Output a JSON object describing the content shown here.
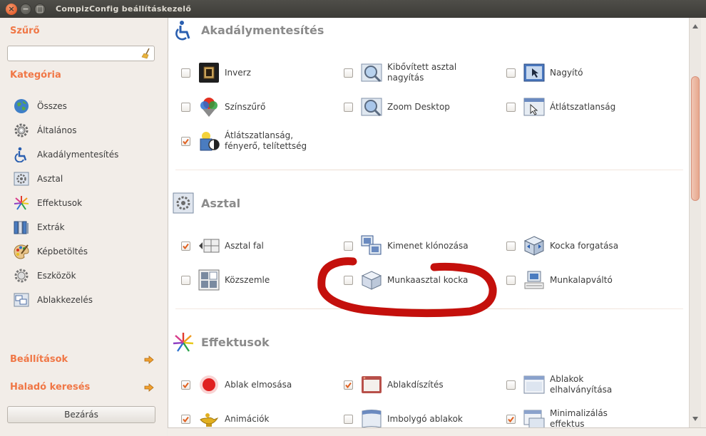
{
  "window": {
    "title": "CompizConfig beállításkezelő"
  },
  "sidebar": {
    "filter_label": "Szűrő",
    "filter_value": "",
    "category_label": "Kategória",
    "categories": [
      "Összes",
      "Általános",
      "Akadálymentesítés",
      "Asztal",
      "Effektusok",
      "Extrák",
      "Képbetöltés",
      "Eszközök",
      "Ablakkezelés"
    ],
    "settings_link": "Beállítások",
    "advanced_search_link": "Haladó keresés",
    "close_button": "Bezárás"
  },
  "sections": [
    {
      "title": "Akadálymentesítés",
      "plugins": [
        {
          "label": "Inverz",
          "checked": false
        },
        {
          "label": "Kibővített asztal nagyítás",
          "checked": false
        },
        {
          "label": "Nagyító",
          "checked": false
        },
        {
          "label": "Színszűrő",
          "checked": false
        },
        {
          "label": "Zoom Desktop",
          "checked": false
        },
        {
          "label": "Átlátszatlanság",
          "checked": false
        },
        {
          "label": "Átlátszatlanság, fényerő, telítettség",
          "checked": true
        }
      ]
    },
    {
      "title": "Asztal",
      "plugins": [
        {
          "label": "Asztal fal",
          "checked": true
        },
        {
          "label": "Kimenet klónozása",
          "checked": false
        },
        {
          "label": "Kocka forgatása",
          "checked": false
        },
        {
          "label": "Közszemle",
          "checked": false
        },
        {
          "label": "Munkaasztal kocka",
          "checked": false
        },
        {
          "label": "Munkalapváltó",
          "checked": false
        }
      ]
    },
    {
      "title": "Effektusok",
      "plugins": [
        {
          "label": "Ablak elmosása",
          "checked": true
        },
        {
          "label": "Ablakdíszítés",
          "checked": true
        },
        {
          "label": "Ablakok elhalványítása",
          "checked": false
        },
        {
          "label": "Animációk",
          "checked": true
        },
        {
          "label": "Imbolygó ablakok",
          "checked": false
        },
        {
          "label": "Minimalizálás effektus",
          "checked": true
        }
      ]
    }
  ],
  "colors": {
    "accent": "#f07746",
    "check": "#e0601f",
    "annotation": "#c4100c"
  }
}
